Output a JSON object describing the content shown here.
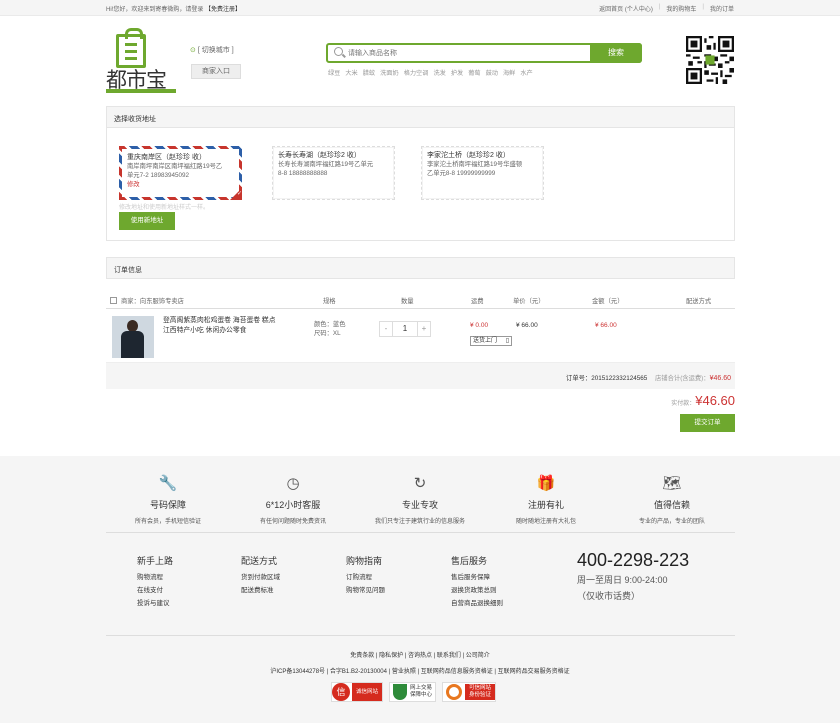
{
  "topbar": {
    "greeting": "Hi!您好，欢迎来到寄春微购，请登录",
    "register": "【免费注册】",
    "links": [
      "返回首页 (个人中心)",
      "我的购物车",
      "我的订单"
    ]
  },
  "logo": {
    "text": "都市宝"
  },
  "header": {
    "city": "[ 切换城市 ]",
    "merchant": "商家入口",
    "search_placeholder": "请输入商品名称",
    "search_btn": "搜索",
    "hot": [
      "绿豆",
      "大米",
      "腊蚊",
      "洗面奶",
      "格力空调",
      "洗发",
      "护发",
      "葡萄",
      "鼓动",
      "海鲜",
      "水产"
    ]
  },
  "address": {
    "title": "选择收货地址",
    "cards": [
      {
        "who": "重庆南岸区（赵珍珍 收）",
        "l1": "南岸南坪南岸区南坪福红路19号乙",
        "l2": "单元7-2  18983945092",
        "edit": "修改"
      },
      {
        "who": "长寿长寿湖（赵珍珍2 收）",
        "l1": "长寿长寿湖南坪福红路19号乙单元",
        "l2": "8-8  18888888888"
      },
      {
        "who": "李家沱土桥（赵珍珍2 收）",
        "l1": "李家沱土桥南坪福红路19号华盛顿",
        "l2": "乙单元8-8  19999999999"
      }
    ],
    "hint": "修改地址和使用新地址样式一样。",
    "new_btn": "使用新地址"
  },
  "order": {
    "title": "订单信息",
    "shop": "商家：向东服饰专卖店",
    "cols": [
      "规格",
      "数量",
      "运费",
      "单价（元）",
      "金额（元）",
      "配送方式"
    ],
    "item": {
      "name1": "登高阁紫蒸肉松鸡蛋卷 海苔蛋卷 糕点",
      "name2": "江西特产小吃 休闲办公零食",
      "spec1": "颜色：蓝色",
      "spec2": "尺码：XL",
      "qty": "1",
      "minus": "-",
      "plus": "+",
      "freight": "¥ 0.00",
      "unit": "¥ 66.00",
      "amount": "¥ 66.00",
      "ship": "送货上门"
    },
    "order_no": "订单号：2015122332124565",
    "shop_total_label": "店铺合计(含运费)：",
    "shop_total": "¥46.60",
    "pay_label": "实付款：",
    "pay": "¥46.60",
    "submit": "提交订单"
  },
  "features": [
    {
      "icon": "wrench-icon",
      "glyph": "🔧",
      "t": "号码保障",
      "d": "所有会员，手机短信验证"
    },
    {
      "icon": "clock-icon",
      "glyph": "◷",
      "t": "6*12小时客服",
      "d": "有任何问题随时免费资讯"
    },
    {
      "icon": "refresh-icon",
      "glyph": "↻",
      "t": "专业专攻",
      "d": "我们只专注于建筑行业的信息服务"
    },
    {
      "icon": "gift-icon",
      "glyph": "🎁",
      "t": "注册有礼",
      "d": "随时随地注册有大礼包"
    },
    {
      "icon": "map-icon",
      "glyph": "🗺",
      "t": "值得信赖",
      "d": "专业的产品，专业的团队"
    }
  ],
  "help": [
    {
      "h": "新手上路",
      "items": [
        "购物流程",
        "在线支付",
        "投诉与建议"
      ]
    },
    {
      "h": "配送方式",
      "items": [
        "货到付款区域",
        "配送费标准"
      ]
    },
    {
      "h": "购物指南",
      "items": [
        "订购流程",
        "购物常见问题"
      ]
    },
    {
      "h": "售后服务",
      "items": [
        "售后服务保障",
        "退换货政策总则",
        "自营商品退换细则"
      ]
    }
  ],
  "phone": {
    "num": "400-2298-223",
    "hours": "周一至周日 9:00-24:00",
    "note": "（仅收市话费）"
  },
  "links": "免責条款  |  隐私保护  |  咨询热点  |  联系我们  |  公司简介",
  "links2": "沪ICP备13044278号  |  合字B1.B2-20130004  |  营业执照  |  互联网药品信息服务资格证  |  互联网药品交易服务资格证",
  "badges": [
    {
      "a": "信",
      "b": "诚信网站"
    },
    {
      "a": "网上交易",
      "b": "保障中心"
    },
    {
      "a": "可信网站",
      "b": "身份验证"
    }
  ]
}
